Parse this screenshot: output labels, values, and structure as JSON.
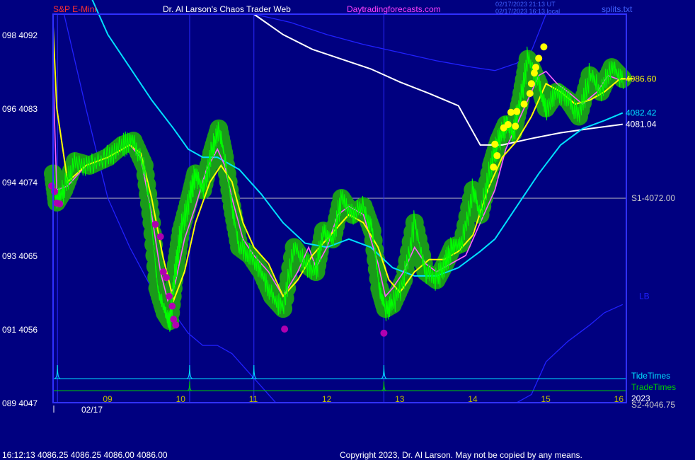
{
  "header": {
    "symbol": "S&P E-Mini",
    "site": "Dr. Al Larson's Chaos Trader Web",
    "url": "Daytradingforecasts.com",
    "timestamp_utc": "02/17/2023 21:13 UT",
    "timestamp_local": "02/17/2023 16:13 local",
    "file": "splits.txt"
  },
  "footer": {
    "quote": "16:12:13  4086.25 4086.25 4086.00 4086.00",
    "copyright": "Copyright 2023, Dr. Al Larson. May not be copied by any means."
  },
  "colors": {
    "background": "#000080",
    "frame": "#3030ff",
    "price": "#00ff00",
    "glow": "#1a9a1a",
    "fast_ma": "#ffff00",
    "medium_ma": "#ff60ff",
    "slow_ma": "#00e0ff",
    "daily_ma": "#ffffff",
    "bands": "#2020ff",
    "tide": "#00e0ff",
    "trade": "#00cc00"
  },
  "chart_data": {
    "type": "line",
    "x_ticks": [
      "09",
      "10",
      "11",
      "12",
      "13",
      "14",
      "15",
      "16"
    ],
    "date_label": "02/17",
    "y_ticks": [
      {
        "label": "098  4092",
        "value": 4092
      },
      {
        "label": "096  4083",
        "value": 4083
      },
      {
        "label": "094  4074",
        "value": 4074
      },
      {
        "label": "093  4065",
        "value": 4065
      },
      {
        "label": "091  4056",
        "value": 4056
      },
      {
        "label": "089  4047",
        "value": 4047
      }
    ],
    "ylim": [
      4047,
      4094.5
    ],
    "xlim": [
      8.25,
      16.1
    ],
    "levels": [
      {
        "label": "S1-4072.00",
        "value": 4072.0
      },
      {
        "label": "S2-4046.75",
        "value": 4046.75
      }
    ],
    "right_labels": [
      {
        "label": "4086.60",
        "value": 4086.6,
        "color": "#ffff00"
      },
      {
        "label": "4082.42",
        "value": 4082.42,
        "color": "#00e0ff"
      },
      {
        "label": "4081.04",
        "value": 4081.04,
        "color": "#ffffff"
      },
      {
        "label": "LB",
        "value": 4060.0,
        "color": "#2020ff"
      }
    ],
    "legend": [
      "TideTimes",
      "TradeTimes",
      "2023"
    ],
    "tide_times": [
      8.31,
      10.12,
      11.0,
      12.78
    ],
    "trade_times": [
      10.12,
      12.78
    ],
    "series": [
      {
        "name": "price",
        "x": [
          8.25,
          8.3,
          8.4,
          8.55,
          8.75,
          9.0,
          9.2,
          9.35,
          9.5,
          9.6,
          9.68,
          9.78,
          9.85,
          9.92,
          10.0,
          10.12,
          10.2,
          10.3,
          10.42,
          10.52,
          10.6,
          10.7,
          10.8,
          10.95,
          11.1,
          11.25,
          11.4,
          11.55,
          11.7,
          11.85,
          11.95,
          12.08,
          12.2,
          12.35,
          12.5,
          12.62,
          12.72,
          12.8,
          12.9,
          13.05,
          13.2,
          13.35,
          13.5,
          13.62,
          13.72,
          13.85,
          14.0,
          14.1,
          14.25,
          14.35,
          14.45,
          14.55,
          14.65,
          14.75,
          14.9,
          15.0,
          15.15,
          15.3,
          15.45,
          15.6,
          15.75,
          15.9,
          16.05
        ],
        "y": [
          4075,
          4071.5,
          4073,
          4076.5,
          4076,
          4077,
          4078.5,
          4079,
          4076,
          4069,
          4061,
          4058,
          4057,
          4063,
          4068,
          4072,
          4075,
          4073,
          4077.5,
          4080.5,
          4077,
          4071,
          4066,
          4065,
          4063,
          4060,
          4058.5,
          4066,
          4064,
          4063,
          4068,
          4067,
          4072,
          4070,
          4071,
          4068,
          4061,
          4058.5,
          4059,
          4062,
          4069,
          4063,
          4062,
          4064,
          4066,
          4066.5,
          4073,
          4070,
          4076,
          4079,
          4081,
          4080,
          4084,
          4089,
          4086,
          4083,
          4085,
          4084,
          4082,
          4087,
          4085,
          4088,
          4086.6
        ]
      },
      {
        "name": "fast",
        "x": [
          8.25,
          8.3,
          8.45,
          8.7,
          9.0,
          9.3,
          9.45,
          9.6,
          9.75,
          9.9,
          10.05,
          10.2,
          10.4,
          10.55,
          10.7,
          10.85,
          11.0,
          11.2,
          11.4,
          11.6,
          11.8,
          11.95,
          12.1,
          12.3,
          12.5,
          12.7,
          12.85,
          13.0,
          13.2,
          13.4,
          13.6,
          13.8,
          14.0,
          14.2,
          14.4,
          14.6,
          14.8,
          15.0,
          15.2,
          15.4,
          15.6,
          15.8,
          16.0,
          16.08
        ],
        "y": [
          4093,
          4083,
          4074,
          4076,
          4077,
          4078.5,
          4077.5,
          4072,
          4065,
          4059.5,
          4063,
          4069,
          4074,
          4076,
          4074,
          4069,
          4066,
          4064,
          4060,
          4062,
          4065,
          4066.5,
          4068,
          4070,
          4069,
          4066,
          4062,
          4060.5,
          4063,
          4064.5,
          4064.5,
          4065.5,
          4067.5,
          4073,
          4077,
          4079,
          4082,
          4086,
          4085,
          4083.5,
          4084,
          4085,
          4086.5,
          4086.6
        ]
      },
      {
        "name": "medium",
        "x": [
          8.25,
          8.3,
          8.45,
          8.7,
          9.0,
          9.3,
          9.45,
          9.6,
          9.72,
          9.82,
          9.92,
          10.05,
          10.2,
          10.35,
          10.5,
          10.6,
          10.7,
          10.85,
          11.0,
          11.2,
          11.4,
          11.6,
          11.75,
          11.85,
          12.0,
          12.15,
          12.3,
          12.5,
          12.7,
          12.8,
          12.9,
          13.05,
          13.2,
          13.35,
          13.5,
          13.7,
          13.9,
          14.05,
          14.2,
          14.3,
          14.45,
          14.6,
          14.75,
          14.9,
          15.0,
          15.15,
          15.3,
          15.5,
          15.7,
          15.85,
          16.0
        ],
        "y": [
          4087,
          4073,
          4073.5,
          4076,
          4077,
          4078.5,
          4077,
          4070,
          4063,
          4059.5,
          4061.5,
          4067,
          4071,
          4075.5,
          4078,
          4076,
          4072,
          4067,
          4065,
          4063,
          4060,
          4063,
          4066,
          4063.5,
          4066,
          4070,
          4071,
          4070,
          4064,
          4060,
          4061,
          4063,
          4066,
          4064,
          4063,
          4064,
          4065,
          4068,
          4071,
          4073,
          4078,
          4081,
          4084,
          4087,
          4087.5,
          4086,
          4085,
          4083.5,
          4085,
          4087,
          4086.5
        ]
      },
      {
        "name": "slow",
        "x": [
          8.75,
          9.0,
          9.3,
          9.6,
          9.9,
          10.1,
          10.3,
          10.5,
          10.8,
          11.1,
          11.4,
          11.7,
          12.0,
          12.3,
          12.6,
          12.9,
          13.2,
          13.5,
          13.8,
          14.1,
          14.3,
          14.6,
          14.9,
          15.2,
          15.5,
          15.8,
          16.05
        ],
        "y": [
          4097,
          4092,
          4088,
          4084,
          4080.5,
          4078,
          4077,
          4077,
          4075.5,
          4072.5,
          4069,
          4066.5,
          4066,
          4067,
          4066,
          4063.5,
          4062.5,
          4062.5,
          4063.5,
          4065.5,
          4067,
          4071,
          4075,
          4078.5,
          4080.5,
          4081.5,
          4082.42
        ]
      },
      {
        "name": "daily",
        "x": [
          11.0,
          11.4,
          11.8,
          12.2,
          12.6,
          13.0,
          13.4,
          13.8,
          14.1,
          14.4,
          14.8,
          15.2,
          15.6,
          16.05
        ],
        "y": [
          4094.5,
          4092,
          4090.2,
          4089,
          4087.8,
          4086.2,
          4084.8,
          4083.3,
          4078.5,
          4078.5,
          4079.3,
          4080,
          4080.5,
          4081.04
        ]
      },
      {
        "name": "upper_band",
        "x": [
          11.0,
          11.5,
          12.0,
          12.5,
          13.0,
          13.5,
          14.0,
          14.3,
          14.6,
          14.8,
          15.0,
          15.3,
          15.7,
          16.05
        ],
        "y": [
          4094.5,
          4093.5,
          4092,
          4090.8,
          4089.8,
          4088.8,
          4088,
          4087.6,
          4088.5,
          4090,
          4094.5,
          4094.5,
          4094.5,
          4094.5
        ]
      },
      {
        "name": "lower_band",
        "x": [
          8.4,
          8.7,
          9.0,
          9.3,
          9.6,
          9.9,
          10.1,
          10.3,
          10.5,
          10.7,
          10.9,
          11.1,
          11.3,
          11.5,
          11.7,
          11.9,
          12.1,
          12.3,
          12.5,
          12.8,
          13.1,
          13.4,
          13.7,
          14.0,
          14.3,
          14.6,
          14.8,
          15.0,
          15.3,
          15.6,
          15.8,
          16.05
        ],
        "y": [
          4094.5,
          4083,
          4072,
          4066,
          4061,
          4058,
          4055.5,
          4054,
          4054,
          4053,
          4051,
          4049,
          4047,
          4047,
          4047,
          4047,
          4047,
          4047,
          4047,
          4047,
          4047,
          4047,
          4047,
          4047,
          4047,
          4047,
          4048,
          4052,
          4054.5,
          4056.5,
          4058,
          4059
        ]
      }
    ],
    "low_markers": [
      [
        8.23,
        4073.5
      ],
      [
        8.27,
        4072.8
      ],
      [
        8.3,
        4071.4
      ],
      [
        8.34,
        4071.3
      ],
      [
        9.65,
        4068.8
      ],
      [
        9.72,
        4067.3
      ],
      [
        9.76,
        4063
      ],
      [
        9.8,
        4062.3
      ],
      [
        9.84,
        4060
      ],
      [
        9.88,
        4058.8
      ],
      [
        9.9,
        4057.2
      ],
      [
        9.93,
        4056.5
      ],
      [
        11.42,
        4056
      ],
      [
        12.78,
        4055.5
      ]
    ],
    "high_markers": [
      [
        14.28,
        4075.8
      ],
      [
        14.3,
        4078.6
      ],
      [
        14.33,
        4077.2
      ],
      [
        14.42,
        4080.6
      ],
      [
        14.48,
        4081
      ],
      [
        14.52,
        4082.5
      ],
      [
        14.58,
        4080.8
      ],
      [
        14.6,
        4082.6
      ],
      [
        14.7,
        4083.5
      ],
      [
        14.78,
        4084.8
      ],
      [
        14.8,
        4086
      ],
      [
        14.84,
        4087.3
      ],
      [
        14.86,
        4088
      ],
      [
        14.9,
        4089.1
      ],
      [
        14.97,
        4090.5
      ]
    ]
  }
}
